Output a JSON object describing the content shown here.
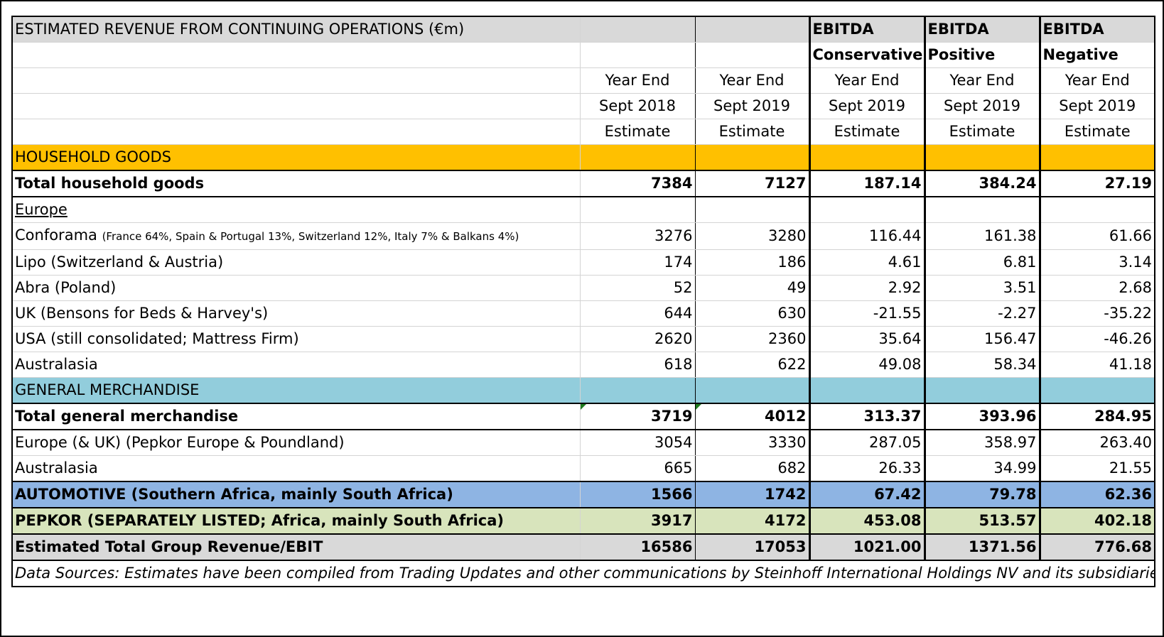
{
  "title": "ESTIMATED REVENUE FROM CONTINUING OPERATIONS (€m)",
  "columns": [
    {
      "top": "",
      "sub": "",
      "lines": [
        "Year End",
        "Sept 2018",
        "Estimate"
      ]
    },
    {
      "top": "",
      "sub": "",
      "lines": [
        "Year End",
        "Sept 2019",
        "Estimate"
      ]
    },
    {
      "top": "EBITDA",
      "sub": "Conservative",
      "lines": [
        "Year End",
        "Sept 2019",
        "Estimate"
      ]
    },
    {
      "top": "EBITDA",
      "sub": "Positive",
      "lines": [
        "Year End",
        "Sept 2019",
        "Estimate"
      ]
    },
    {
      "top": "EBITDA",
      "sub": "Negative",
      "lines": [
        "Year End",
        "Sept 2019",
        "Estimate"
      ]
    }
  ],
  "sections": {
    "household": "HOUSEHOLD GOODS",
    "general": "GENERAL MERCHANDISE"
  },
  "rows": {
    "total_household": {
      "label": "Total household goods",
      "values": [
        "7384",
        "7127",
        "187.14",
        "384.24",
        "27.19"
      ]
    },
    "europe": {
      "label": "Europe"
    },
    "conforama": {
      "label": "Conforama",
      "note": "(France 64%, Spain & Portugal 13%, Switzerland 12%, Italy 7% & Balkans 4%)",
      "values": [
        "3276",
        "3280",
        "116.44",
        "161.38",
        "61.66"
      ]
    },
    "lipo": {
      "label": "Lipo (Switzerland & Austria)",
      "values": [
        "174",
        "186",
        "4.61",
        "6.81",
        "3.14"
      ]
    },
    "abra": {
      "label": "Abra (Poland)",
      "values": [
        "52",
        "49",
        "2.92",
        "3.51",
        "2.68"
      ]
    },
    "uk": {
      "label": "UK (Bensons for Beds & Harvey's)",
      "values": [
        "644",
        "630",
        "-21.55",
        "-2.27",
        "-35.22"
      ]
    },
    "usa": {
      "label": "USA (still consolidated; Mattress Firm)",
      "values": [
        "2620",
        "2360",
        "35.64",
        "156.47",
        "-46.26"
      ]
    },
    "australasia_hh": {
      "label": "Australasia",
      "values": [
        "618",
        "622",
        "49.08",
        "58.34",
        "41.18"
      ]
    },
    "total_general": {
      "label": "Total general merchandise",
      "values": [
        "3719",
        "4012",
        "313.37",
        "393.96",
        "284.95"
      ]
    },
    "europe_uk": {
      "label": "Europe (& UK) (Pepkor Europe & Poundland)",
      "values": [
        "3054",
        "3330",
        "287.05",
        "358.97",
        "263.40"
      ]
    },
    "australasia_gm": {
      "label": "Australasia",
      "values": [
        "665",
        "682",
        "26.33",
        "34.99",
        "21.55"
      ]
    },
    "automotive": {
      "label": "AUTOMOTIVE (Southern Africa, mainly South Africa)",
      "values": [
        "1566",
        "1742",
        "67.42",
        "79.78",
        "62.36"
      ]
    },
    "pepkor": {
      "label": "PEPKOR (SEPARATELY LISTED; Africa, mainly South Africa)",
      "values": [
        "3917",
        "4172",
        "453.08",
        "513.57",
        "402.18"
      ]
    },
    "group_total": {
      "label": "Estimated Total Group Revenue/EBIT",
      "values": [
        "16586",
        "17053",
        "1021.00",
        "1371.56",
        "776.68"
      ]
    }
  },
  "footnote": "Data Sources: Estimates have been compiled from Trading Updates and other communications by Steinhoff International Holdings NV and its subsidiaries as well as from the Annual Financial Statements and Trading Updates provided by Pepkor Holdings LTD.",
  "colors": {
    "header_grey": "#d9d9d9",
    "household_orange": "#ffc000",
    "general_teal": "#92cddc",
    "automotive_blue": "#8eb4e3",
    "pepkor_green": "#d8e4bc"
  }
}
